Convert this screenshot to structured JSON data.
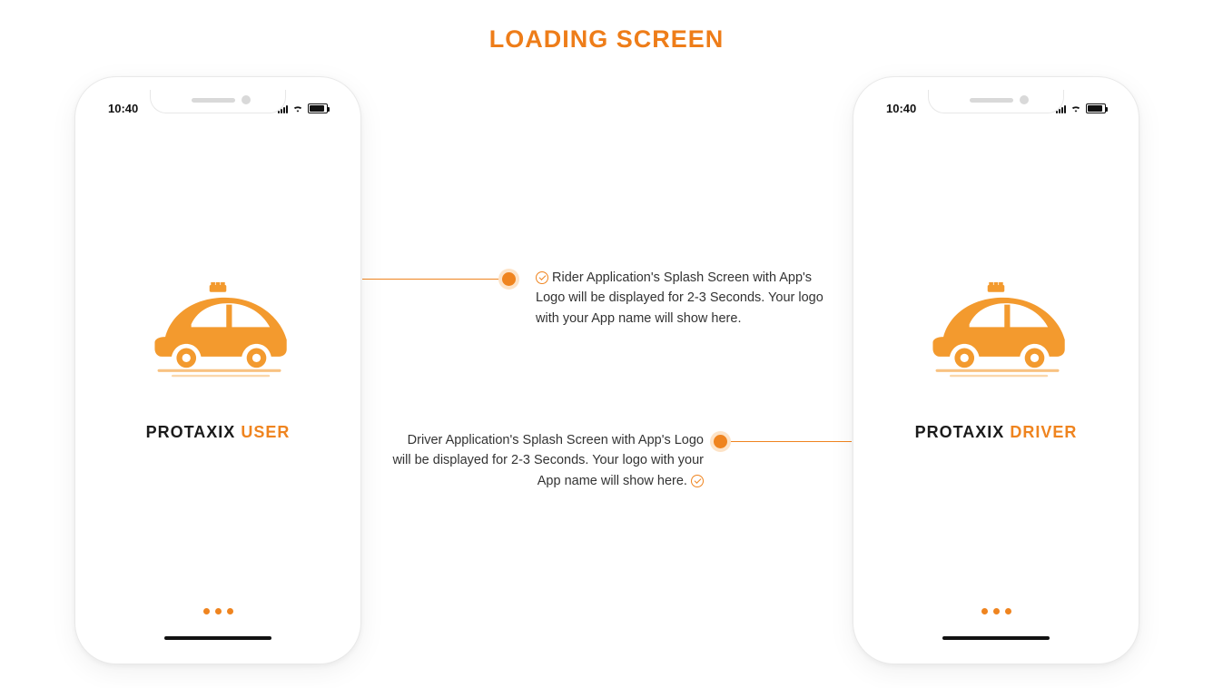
{
  "page": {
    "title": "LOADING SCREEN"
  },
  "status": {
    "time": "10:40"
  },
  "brand": {
    "name": "PROTAXIX"
  },
  "phones": {
    "user": {
      "role": "USER"
    },
    "driver": {
      "role": "DRIVER"
    }
  },
  "callouts": {
    "rider": "Rider Application's Splash Screen with App's Logo will be displayed for 2-3 Seconds. Your logo with your App name will show here.",
    "driver": "Driver Application's Splash Screen with App's Logo will be displayed for 2-3 Seconds. Your logo with your App name will show here."
  }
}
